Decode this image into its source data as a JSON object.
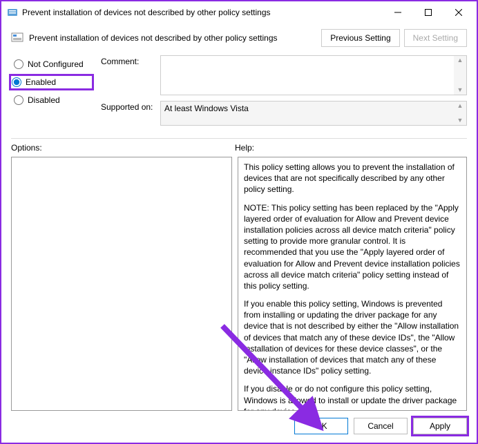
{
  "window": {
    "title": "Prevent installation of devices not described by other policy settings"
  },
  "header": {
    "text": "Prevent installation of devices not described by other policy settings",
    "prev_label": "Previous Setting",
    "next_label": "Next Setting"
  },
  "radios": {
    "not_configured": "Not Configured",
    "enabled": "Enabled",
    "disabled": "Disabled"
  },
  "form": {
    "comment_label": "Comment:",
    "comment_value": "",
    "supported_label": "Supported on:",
    "supported_value": "At least Windows Vista"
  },
  "labels": {
    "options": "Options:",
    "help": "Help:"
  },
  "help": {
    "p1": "This policy setting allows you to prevent the installation of devices that are not specifically described by any other policy setting.",
    "p2": "NOTE: This policy setting has been replaced by the \"Apply layered order of evaluation for Allow and Prevent device installation policies across all device match criteria\" policy setting to provide more granular control. It is recommended that you use the \"Apply layered order of evaluation for Allow and Prevent device installation policies across all device match criteria\" policy setting instead of this policy setting.",
    "p3": "If you enable this policy setting, Windows is prevented from installing or updating the driver package for any device that is not described by either the \"Allow installation of devices that match any of these device IDs\", the \"Allow installation of devices for these device classes\", or the \"Allow installation of devices that match any of these device instance IDs\" policy setting.",
    "p4": "If you disable or do not configure this policy setting, Windows is allowed to install or update the driver package for any device"
  },
  "footer": {
    "ok": "OK",
    "cancel": "Cancel",
    "apply": "Apply"
  }
}
